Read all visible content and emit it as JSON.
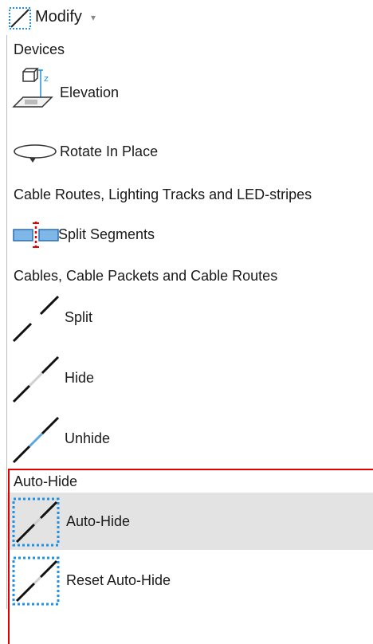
{
  "toolbar": {
    "modify_label": "Modify",
    "modify_icon": "dashed-box-line-icon",
    "dropdown_icon": "chevron-down-icon"
  },
  "menu": {
    "sections": [
      {
        "header": "Devices",
        "items": [
          {
            "label": "Elevation",
            "icon": "elevation-icon"
          },
          {
            "label": "Rotate In Place",
            "icon": "rotate-icon"
          }
        ]
      },
      {
        "header": "Cable Routes, Lighting Tracks and LED-stripes",
        "items": [
          {
            "label": "Split Segments",
            "icon": "split-segments-icon"
          }
        ]
      },
      {
        "header": "Cables, Cable Packets and Cable Routes",
        "items": [
          {
            "label": "Split",
            "icon": "split-line-icon"
          },
          {
            "label": "Hide",
            "icon": "hide-line-icon"
          },
          {
            "label": "Unhide",
            "icon": "unhide-line-icon"
          }
        ]
      },
      {
        "header": "Auto-Hide",
        "items": [
          {
            "label": "Auto-Hide",
            "icon": "auto-hide-icon",
            "highlighted": true
          },
          {
            "label": "Reset Auto-Hide",
            "icon": "reset-auto-hide-icon"
          }
        ]
      }
    ]
  },
  "colors": {
    "highlight": "#e3e3e3",
    "selection_border": "#e00000",
    "icon_blue": "#1e90e6",
    "divider": "#bdbdbd"
  }
}
